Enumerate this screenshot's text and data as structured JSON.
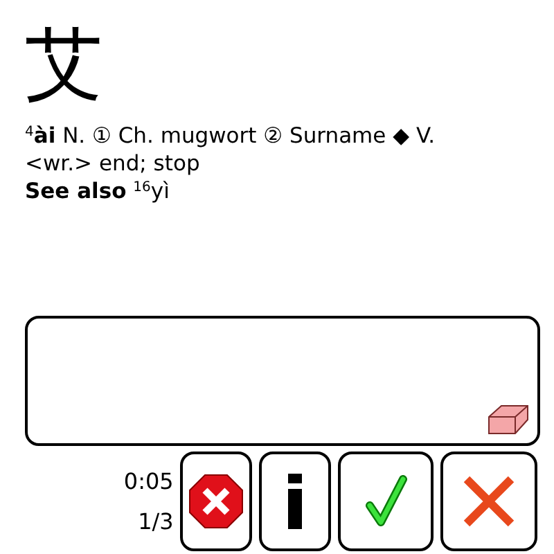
{
  "character": "艾",
  "definition": "$^{4}$**ài** N. ① Ch. mugwort ② Surname ◆ V. <wr.> end; stop",
  "see_also": "**See also** $^{16}$yì",
  "timer": "0:05",
  "progress": "1/3",
  "buttons": [
    {
      "kind": "stop"
    },
    {
      "kind": "info"
    },
    {
      "kind": "check"
    },
    {
      "kind": "cross"
    }
  ]
}
